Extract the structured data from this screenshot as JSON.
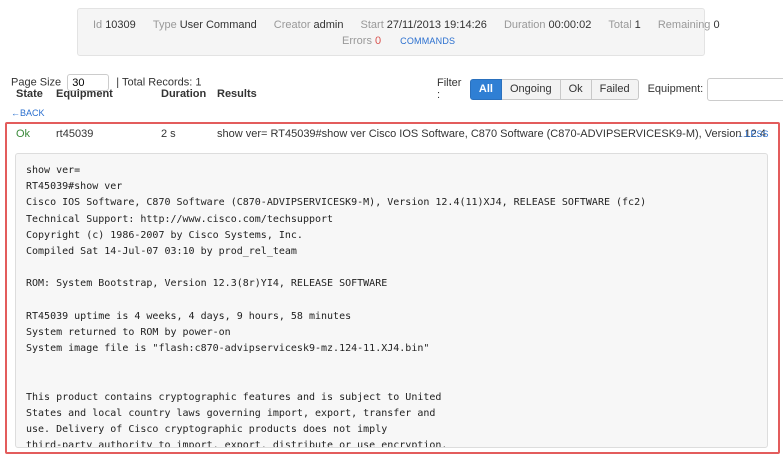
{
  "summary": {
    "id_label": "Id",
    "id_value": "10309",
    "type_label": "Type",
    "type_value": "User Command",
    "creator_label": "Creator",
    "creator_value": "admin",
    "start_label": "Start",
    "start_value": "27/11/2013 19:14:26",
    "duration_label": "Duration",
    "duration_value": "00:00:02",
    "total_label": "Total",
    "total_value": "1",
    "remaining_label": "Remaining",
    "remaining_value": "0",
    "errors_label": "Errors",
    "errors_value": "0",
    "commands_link": "COMMANDS"
  },
  "toolbar": {
    "page_size_label": "Page Size",
    "page_size_value": "30",
    "total_records": "| Total Records: 1"
  },
  "columns": {
    "state": "State",
    "equipment": "Equipment",
    "duration": "Duration",
    "results": "Results"
  },
  "filter": {
    "label": "Filter :",
    "buttons": [
      "All",
      "Ongoing",
      "Ok",
      "Failed"
    ],
    "equipment_label": "Equipment:"
  },
  "back_link": "←BACK",
  "result": {
    "state": "Ok",
    "equipment": "rt45039",
    "duration": "2 s",
    "summary": "show ver= RT45039#show ver Cisco IOS Software, C870 Software (C870-ADVIPSERVICESK9-M), Version 12.4",
    "less_link": "...LESS",
    "output_lines": [
      "show ver=",
      "RT45039#show ver",
      "Cisco IOS Software, C870 Software (C870-ADVIPSERVICESK9-M), Version 12.4(11)XJ4, RELEASE SOFTWARE (fc2)",
      "Technical Support: http://www.cisco.com/techsupport",
      "Copyright (c) 1986-2007 by Cisco Systems, Inc.",
      "Compiled Sat 14-Jul-07 03:10 by prod_rel_team",
      "",
      "ROM: System Bootstrap, Version 12.3(8r)YI4, RELEASE SOFTWARE",
      "",
      "RT45039 uptime is 4 weeks, 4 days, 9 hours, 58 minutes",
      "System returned to ROM by power-on",
      "System image file is \"flash:c870-advipservicesk9-mz.124-11.XJ4.bin\"",
      "",
      "",
      "This product contains cryptographic features and is subject to United",
      "States and local country laws governing import, export, transfer and",
      "use. Delivery of Cisco cryptographic products does not imply",
      "third-party authority to import, export, distribute or use encryption."
    ]
  }
}
